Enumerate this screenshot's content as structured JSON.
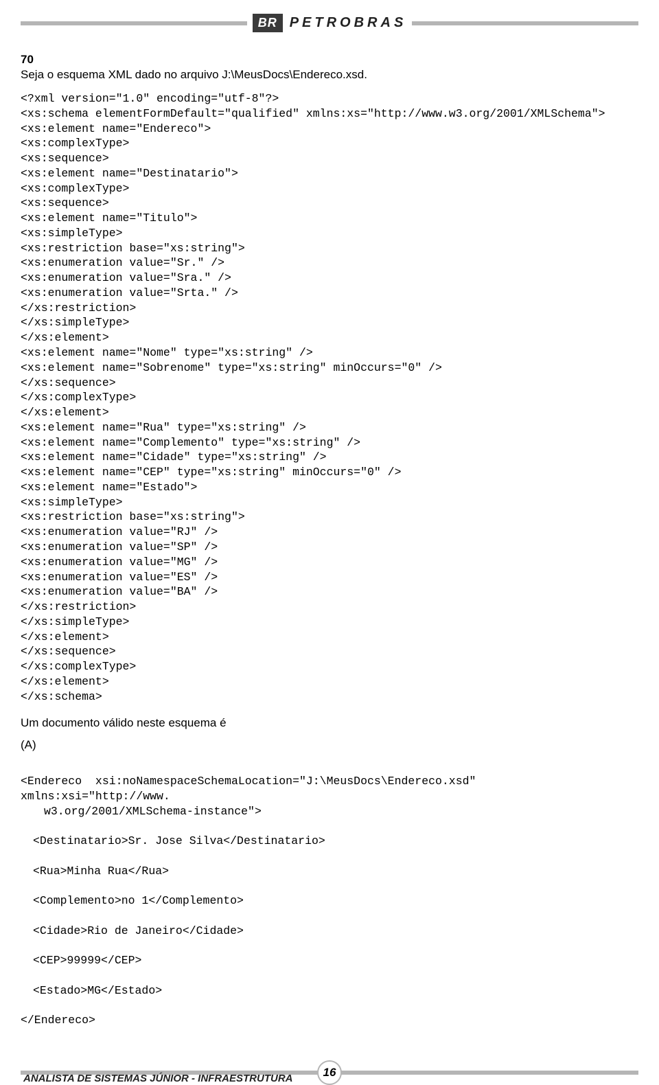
{
  "header": {
    "logo_short": "BR",
    "logo_full": "PETROBRAS"
  },
  "question": {
    "number": "70",
    "intro": "Seja o esquema XML dado no arquivo J:\\MeusDocs\\Endereco.xsd.",
    "schema_code": "<?xml version=\"1.0\" encoding=\"utf-8\"?>\n<xs:schema elementFormDefault=\"qualified\" xmlns:xs=\"http://www.w3.org/2001/XMLSchema\">\n<xs:element name=\"Endereco\">\n<xs:complexType>\n<xs:sequence>\n<xs:element name=\"Destinatario\">\n<xs:complexType>\n<xs:sequence>\n<xs:element name=\"Titulo\">\n<xs:simpleType>\n<xs:restriction base=\"xs:string\">\n<xs:enumeration value=\"Sr.\" />\n<xs:enumeration value=\"Sra.\" />\n<xs:enumeration value=\"Srta.\" />\n</xs:restriction>\n</xs:simpleType>\n</xs:element>\n<xs:element name=\"Nome\" type=\"xs:string\" />\n<xs:element name=\"Sobrenome\" type=\"xs:string\" minOccurs=\"0\" />\n</xs:sequence>\n</xs:complexType>\n</xs:element>\n<xs:element name=\"Rua\" type=\"xs:string\" />\n<xs:element name=\"Complemento\" type=\"xs:string\" />\n<xs:element name=\"Cidade\" type=\"xs:string\" />\n<xs:element name=\"CEP\" type=\"xs:string\" minOccurs=\"0\" />\n<xs:element name=\"Estado\">\n<xs:simpleType>\n<xs:restriction base=\"xs:string\">\n<xs:enumeration value=\"RJ\" />\n<xs:enumeration value=\"SP\" />\n<xs:enumeration value=\"MG\" />\n<xs:enumeration value=\"ES\" />\n<xs:enumeration value=\"BA\" />\n</xs:restriction>\n</xs:simpleType>\n</xs:element>\n</xs:sequence>\n</xs:complexType>\n</xs:element>\n</xs:schema>",
    "valid_doc_text": "Um documento válido neste esquema é",
    "option_label": "(A)",
    "option_a": {
      "line1": "<Endereco  xsi:noNamespaceSchemaLocation=\"J:\\MeusDocs\\Endereco.xsd\"  xmlns:xsi=\"http://www.",
      "line1b": "w3.org/2001/XMLSchema-instance\">",
      "l2": "<Destinatario>Sr. Jose Silva</Destinatario>",
      "l3": "<Rua>Minha Rua</Rua>",
      "l4": "<Complemento>no 1</Complemento>",
      "l5": "<Cidade>Rio de Janeiro</Cidade>",
      "l6": "<CEP>99999</CEP>",
      "l7": "<Estado>MG</Estado>",
      "l8": "</Endereco>"
    }
  },
  "footer": {
    "title": "ANALISTA DE SISTEMAS JÚNIOR - INFRAESTRUTURA",
    "page": "16"
  }
}
